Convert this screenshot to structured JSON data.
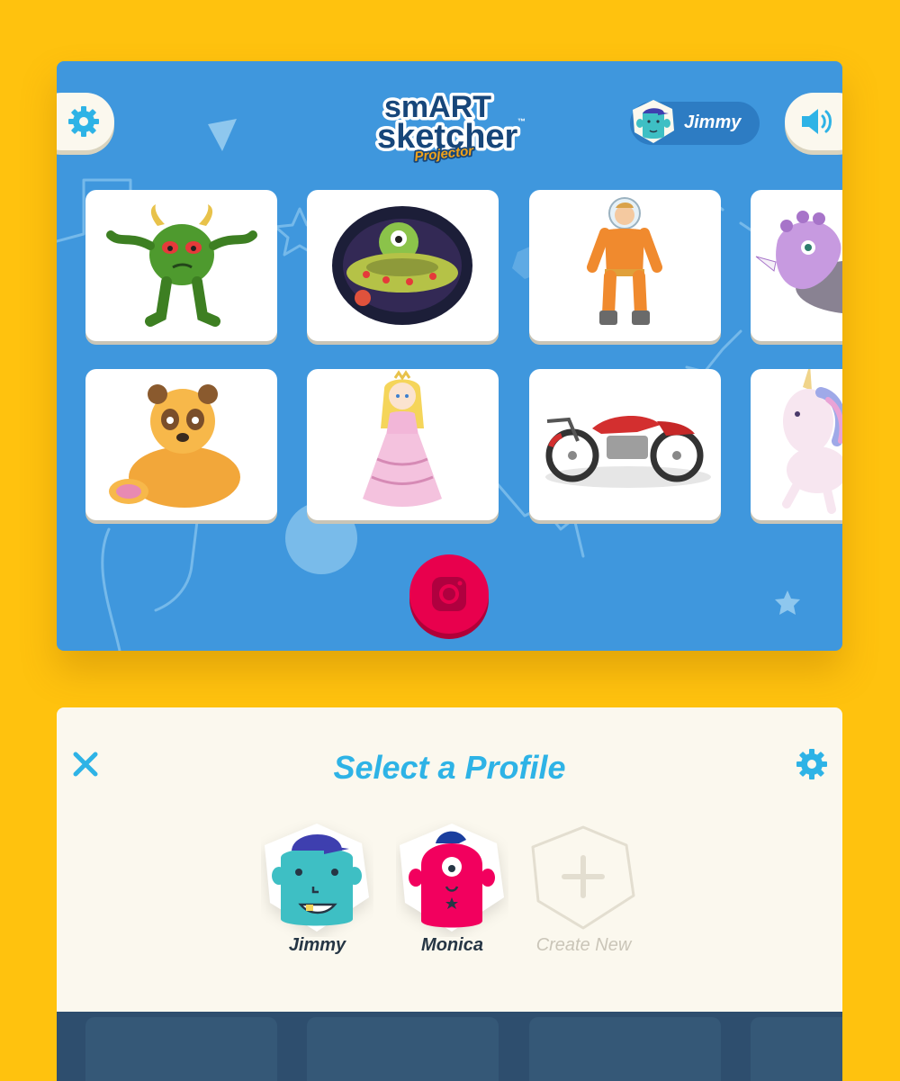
{
  "app": {
    "logo_line1": "smART",
    "logo_line2": "sketcher",
    "logo_tagline": "Projector",
    "trademark": "™"
  },
  "header": {
    "user_name": "Jimmy",
    "settings_icon": "gear-icon",
    "sound_icon": "speaker-icon"
  },
  "gallery": {
    "cards": [
      {
        "subject": "green monster"
      },
      {
        "subject": "alien in flying saucer"
      },
      {
        "subject": "astronaut"
      },
      {
        "subject": "purple triceratops"
      },
      {
        "subject": "panda bear"
      },
      {
        "subject": "princess"
      },
      {
        "subject": "red motorcycle"
      },
      {
        "subject": "unicorn"
      }
    ]
  },
  "camera": {
    "icon": "camera-icon"
  },
  "profile_panel": {
    "title": "Select a Profile",
    "profiles": [
      {
        "name": "Jimmy"
      },
      {
        "name": "Monica"
      }
    ],
    "create_label": "Create New"
  },
  "colors": {
    "background": "#FFC20E",
    "screen_blue": "#3F97DD",
    "panel": "#FBF8EE",
    "accent_cyan": "#2EB3E6",
    "shutter_pink": "#E8004D",
    "avatar_teal": "#3EBFC4",
    "avatar_pink": "#F2005E"
  }
}
